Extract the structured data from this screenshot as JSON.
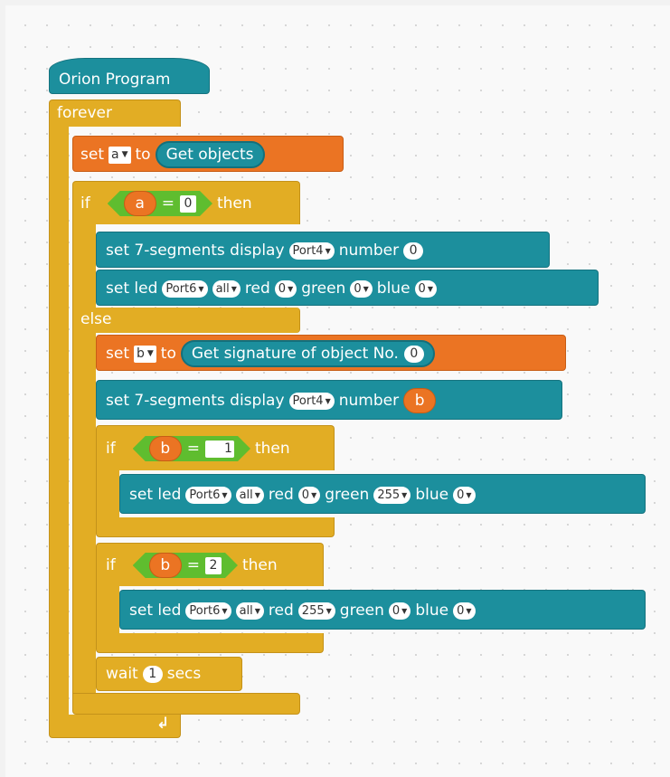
{
  "hat": {
    "label": "Orion Program"
  },
  "forever": {
    "label": "forever"
  },
  "set_a": {
    "set": "set",
    "var": "a",
    "to": "to",
    "reporter": "Get objects"
  },
  "if1": {
    "if": "if",
    "var": "a",
    "op": "=",
    "value": "0",
    "then": "then"
  },
  "seg1": {
    "label": "set 7-segments display",
    "port": "Port4",
    "number_label": "number",
    "number": "0"
  },
  "led1": {
    "set_led": "set led",
    "port": "Port6",
    "which": "all",
    "red_label": "red",
    "red": "0",
    "green_label": "green",
    "green": "0",
    "blue_label": "blue",
    "blue": "0"
  },
  "else": {
    "label": "else"
  },
  "set_b": {
    "set": "set",
    "var": "b",
    "to": "to",
    "reporter": "Get signature of object No.",
    "reporter_arg": "0"
  },
  "seg2": {
    "label": "set 7-segments display",
    "port": "Port4",
    "number_label": "number",
    "var": "b"
  },
  "if2": {
    "if": "if",
    "var": "b",
    "op": "=",
    "value": "1",
    "then": "then"
  },
  "led2": {
    "set_led": "set led",
    "port": "Port6",
    "which": "all",
    "red_label": "red",
    "red": "0",
    "green_label": "green",
    "green": "255",
    "blue_label": "blue",
    "blue": "0"
  },
  "if3": {
    "if": "if",
    "var": "b",
    "op": "=",
    "value": "2",
    "then": "then"
  },
  "led3": {
    "set_led": "set led",
    "port": "Port6",
    "which": "all",
    "red_label": "red",
    "red": "255",
    "green_label": "green",
    "green": "0",
    "blue_label": "blue",
    "blue": "0"
  },
  "wait": {
    "label": "wait",
    "value": "1",
    "unit": "secs"
  },
  "icons": {
    "dropdown": "dropdown-arrow-icon",
    "loop": "loop-arrow-icon"
  },
  "colors": {
    "control": "#e2ad24",
    "teal": "#1c8f9d",
    "orange": "#eb7423",
    "green": "#5fbd2f"
  }
}
